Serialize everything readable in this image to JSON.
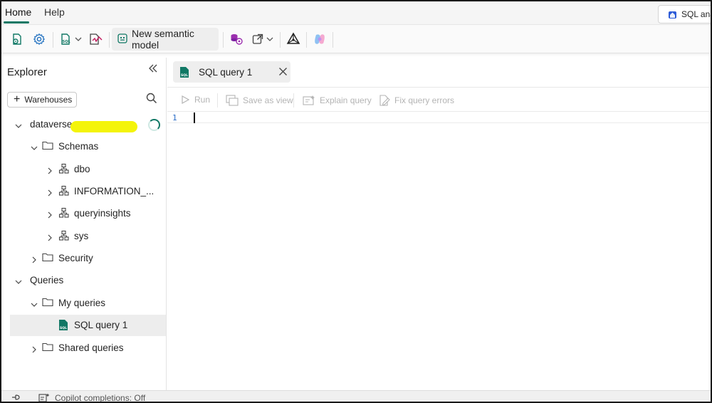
{
  "menubar": {
    "tabs": [
      {
        "label": "Home",
        "active": true
      },
      {
        "label": "Help",
        "active": false
      }
    ],
    "sql_endpoint_label": "SQL ana"
  },
  "ribbon": {
    "new_semantic_model_label": "New semantic model",
    "icons": [
      "new-sql-query-icon",
      "settings-gear-icon",
      "sql-file-icon",
      "dropdown-chevron-icon",
      "visual-query-icon",
      "dataflow-icon",
      "open-external-icon",
      "graph-model-icon",
      "copilot-icon"
    ]
  },
  "explorer": {
    "title": "Explorer",
    "add_warehouses_label": "Warehouses",
    "tree": {
      "database_name": "dataverse",
      "schemas_label": "Schemas",
      "schema_items": [
        "dbo",
        "INFORMATION_...",
        "queryinsights",
        "sys"
      ],
      "security_label": "Security",
      "queries_label": "Queries",
      "my_queries_label": "My queries",
      "my_query_item": "SQL query 1",
      "shared_queries_label": "Shared queries"
    }
  },
  "editor": {
    "tab_label": "SQL query 1",
    "toolbar": {
      "run": "Run",
      "save_as_view": "Save as view",
      "explain_query": "Explain query",
      "fix_query_errors": "Fix query errors"
    },
    "line_numbers": [
      "1"
    ]
  },
  "statusbar": {
    "copilot_completions": "Copilot completions: Off"
  },
  "colors": {
    "accent": "#117865",
    "highlight": "#f4f40a",
    "selected_row": "#ededed"
  }
}
